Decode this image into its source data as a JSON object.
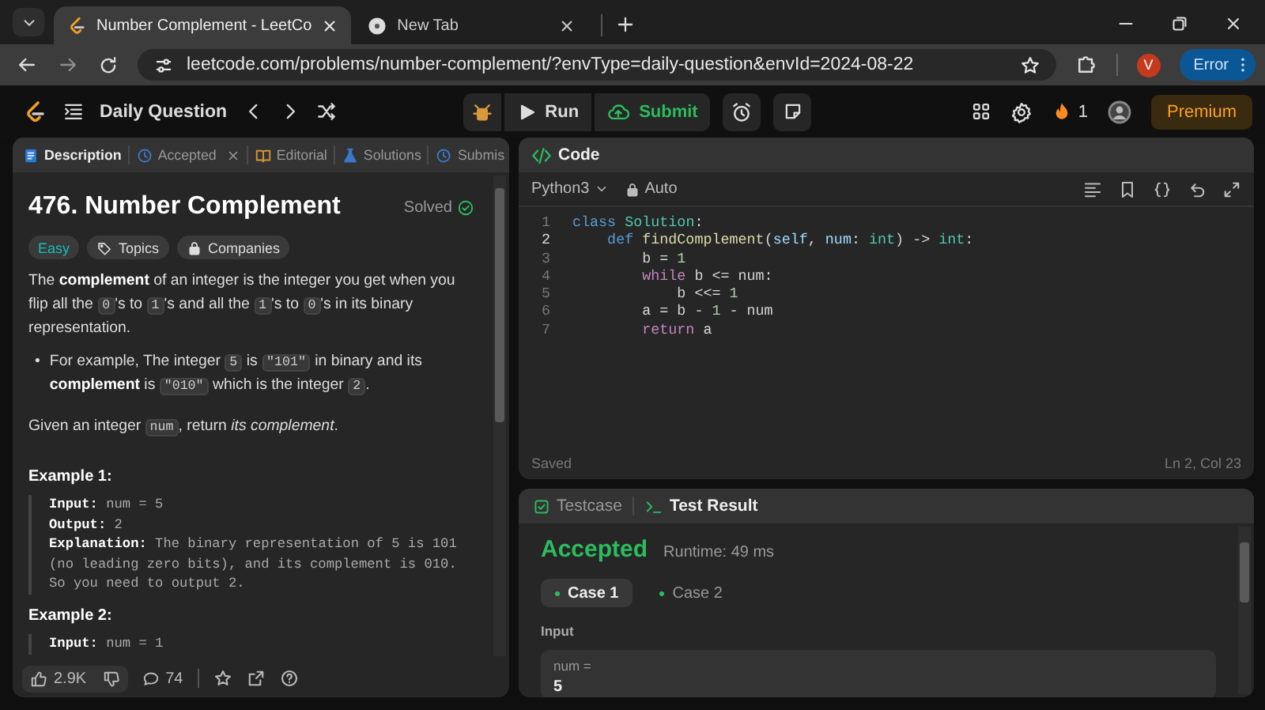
{
  "browser": {
    "tabs": [
      {
        "title": "Number Complement - LeetCo",
        "selected": true,
        "kind": "leetcode"
      },
      {
        "title": "New Tab",
        "selected": false,
        "kind": "newtab"
      }
    ],
    "url": "leetcode.com/problems/number-complement/?envType=daily-question&envId=2024-08-22",
    "profile_initial": "V",
    "profile_status": "Error"
  },
  "nav": {
    "title": "Daily Question",
    "run": "Run",
    "submit": "Submit",
    "streak": "1",
    "premium": "Premium"
  },
  "description": {
    "tabs": [
      {
        "label": "Description",
        "kind": "description",
        "selected": true,
        "closable": false
      },
      {
        "label": "Accepted",
        "kind": "accepted",
        "selected": false,
        "closable": true
      },
      {
        "label": "Editorial",
        "kind": "editorial",
        "selected": false,
        "closable": false
      },
      {
        "label": "Solutions",
        "kind": "solutions",
        "selected": false,
        "closable": false
      },
      {
        "label": "Submis",
        "kind": "submissions",
        "selected": false,
        "closable": false
      }
    ],
    "title": "476. Number Complement",
    "status": "Solved",
    "tags": [
      {
        "label": "Easy",
        "kind": "difficulty"
      },
      {
        "label": "Topics",
        "kind": "topics"
      },
      {
        "label": "Companies",
        "kind": "companies"
      }
    ],
    "paragraphs": [
      [
        {
          "kind": "text",
          "text": "The **complement** of an integer is the integer you get when you flip all the "
        },
        {
          "kind": "code",
          "text": "0"
        },
        {
          "kind": "text",
          "text": "'s to "
        },
        {
          "kind": "code",
          "text": "1"
        },
        {
          "kind": "text",
          "text": "'s and all the "
        },
        {
          "kind": "code",
          "text": "1"
        },
        {
          "kind": "text",
          "text": "'s to "
        },
        {
          "kind": "code",
          "text": "0"
        },
        {
          "kind": "text",
          "text": "'s in its binary representation."
        }
      ]
    ],
    "bullets": [
      {
        "marker": "•",
        "parts": [
          {
            "kind": "text",
            "text": "For example, The integer "
          },
          {
            "kind": "code",
            "text": "5"
          },
          {
            "kind": "text",
            "text": " is "
          },
          {
            "kind": "code",
            "text": "\"101\""
          },
          {
            "kind": "text",
            "text": " in binary and its **complement** is "
          },
          {
            "kind": "code",
            "text": "\"010\""
          },
          {
            "kind": "text",
            "text": " which is the integer "
          },
          {
            "kind": "code",
            "text": "2"
          },
          {
            "kind": "text",
            "text": "."
          }
        ]
      }
    ],
    "closing": [
      {
        "kind": "text",
        "text": "Given an integer "
      },
      {
        "kind": "code",
        "text": "num"
      },
      {
        "kind": "text",
        "text": ", return *its complement*."
      }
    ],
    "examples": [
      {
        "title": "Example 1:",
        "lines": [
          {
            "label": "Input:",
            "value": "num = 5"
          },
          {
            "label": "Output:",
            "value": "2"
          },
          {
            "label": "Explanation:",
            "value": "The binary representation of 5 is 101 (no leading zero bits), and its complement is 010.\nSo you need to output 2."
          }
        ]
      },
      {
        "title": "Example 2:",
        "lines": [
          {
            "label": "Input:",
            "value": "num = 1"
          }
        ]
      }
    ],
    "footer": {
      "likes": "2.9K",
      "comments": "74"
    }
  },
  "editor": {
    "title": "Code",
    "language": "Python3",
    "mode": "Auto",
    "status": "Saved",
    "cursor": "Ln 2, Col 23",
    "lines": [
      {
        "number": "1",
        "current": false,
        "tokens": [
          {
            "kind": "keyword",
            "text": "class "
          },
          {
            "kind": "type",
            "text": "Solution"
          },
          {
            "kind": "plain",
            "text": ":"
          }
        ]
      },
      {
        "number": "2",
        "current": true,
        "tokens": [
          {
            "kind": "keyword",
            "text": "    def "
          },
          {
            "kind": "function",
            "text": "findComplement"
          },
          {
            "kind": "plain",
            "text": "("
          },
          {
            "kind": "variable",
            "text": "self"
          },
          {
            "kind": "plain",
            "text": ", "
          },
          {
            "kind": "variable",
            "text": "num"
          },
          {
            "kind": "plain",
            "text": ": "
          },
          {
            "kind": "type",
            "text": "int"
          },
          {
            "kind": "plain",
            "text": ") -> "
          },
          {
            "kind": "type",
            "text": "int"
          },
          {
            "kind": "plain",
            "text": ":"
          }
        ]
      },
      {
        "number": "3",
        "current": false,
        "tokens": [
          {
            "kind": "plain",
            "text": "        b = "
          },
          {
            "kind": "number",
            "text": "1"
          }
        ]
      },
      {
        "number": "4",
        "current": false,
        "tokens": [
          {
            "kind": "control",
            "text": "        while"
          },
          {
            "kind": "plain",
            "text": " b <= num:"
          }
        ]
      },
      {
        "number": "5",
        "current": false,
        "tokens": [
          {
            "kind": "plain",
            "text": "            b <<= "
          },
          {
            "kind": "number",
            "text": "1"
          }
        ]
      },
      {
        "number": "6",
        "current": false,
        "tokens": [
          {
            "kind": "plain",
            "text": "        a = b - "
          },
          {
            "kind": "number",
            "text": "1"
          },
          {
            "kind": "plain",
            "text": " - num"
          }
        ]
      },
      {
        "number": "7",
        "current": false,
        "tokens": [
          {
            "kind": "control",
            "text": "        return"
          },
          {
            "kind": "plain",
            "text": " a"
          }
        ]
      }
    ]
  },
  "result": {
    "tabs": [
      {
        "label": "Testcase",
        "kind": "testcase",
        "selected": false
      },
      {
        "label": "Test Result",
        "kind": "result",
        "selected": true
      }
    ],
    "verdict": "Accepted",
    "runtime": "Runtime: 49 ms",
    "cases": [
      {
        "label": "Case 1",
        "selected": true
      },
      {
        "label": "Case 2",
        "selected": false
      }
    ],
    "input_label": "Input",
    "param": "num =",
    "value": "5"
  }
}
